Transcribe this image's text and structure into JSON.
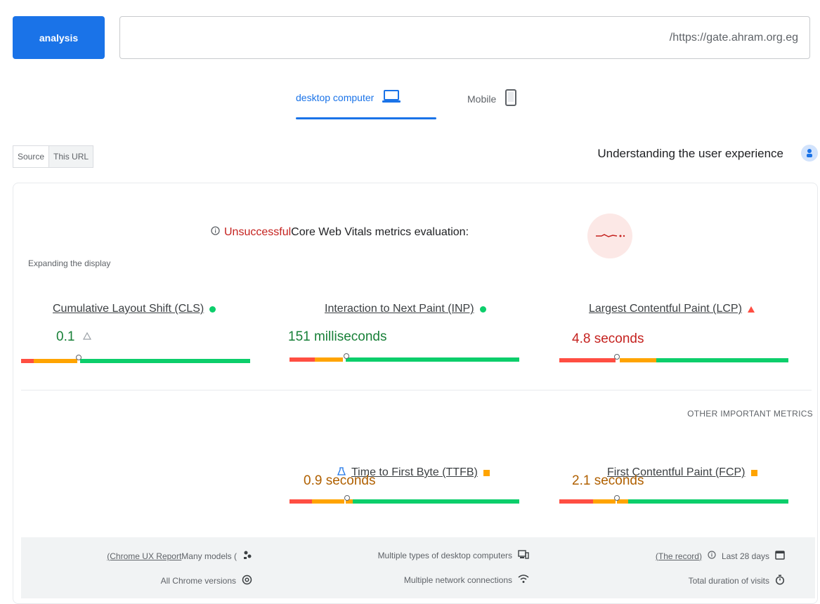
{
  "toolbar": {
    "analyze_label": "analysis",
    "url_value": "/https://gate.ahram.org.eg"
  },
  "tabs": [
    {
      "label": "desktop computer",
      "icon": "laptop-icon",
      "active": true
    },
    {
      "label": "Mobile",
      "icon": "phone-icon",
      "active": false
    }
  ],
  "source_toggle": {
    "source": "Source",
    "this_url": "This URL"
  },
  "ux_title": "Understanding the user experience",
  "assessment": {
    "status": "Unsuccessful",
    "text": "Core Web Vitals metrics evaluation:"
  },
  "expand_text": "Expanding the display",
  "core_metrics": [
    {
      "title": "Cumulative Layout Shift (CLS)",
      "value": "0.1",
      "status": "good",
      "value_color": "#188038",
      "bar_position": 0.25
    },
    {
      "title": "Interaction to Next Paint (INP)",
      "value": "151 milliseconds",
      "status": "good",
      "value_color": "#188038",
      "bar_position": 0.25
    },
    {
      "title": "Largest Contentful Paint (LCP)",
      "value": "4.8 seconds",
      "status": "poor",
      "value_color": "#c5221f",
      "bar_position": 0.25
    }
  ],
  "other_label": "OTHER IMPORTANT METRICS",
  "other_metrics": [
    {
      "title": "Time to First Byte (TTFB)",
      "value": "0.9 seconds",
      "status": "needs-improvement",
      "value_color": "#b06000",
      "bar_position": 0.25
    },
    {
      "title": "First Contentful Paint (FCP)",
      "value": "2.1 seconds",
      "status": "needs-improvement",
      "value_color": "#b06000",
      "bar_position": 0.25
    }
  ],
  "footer": {
    "crux_link": "(Chrome UX Report",
    "models": "Many models (",
    "desktop_types": "Multiple types of desktop computers",
    "record_link": "(The record)",
    "period": "Last 28 days",
    "chrome_versions": "All Chrome versions",
    "network": "Multiple network connections",
    "duration": "Total duration of visits"
  },
  "colors": {
    "accent": "#1a73e8",
    "good": "#0cce6b",
    "average": "#ffa400",
    "poor": "#ff4e42"
  }
}
